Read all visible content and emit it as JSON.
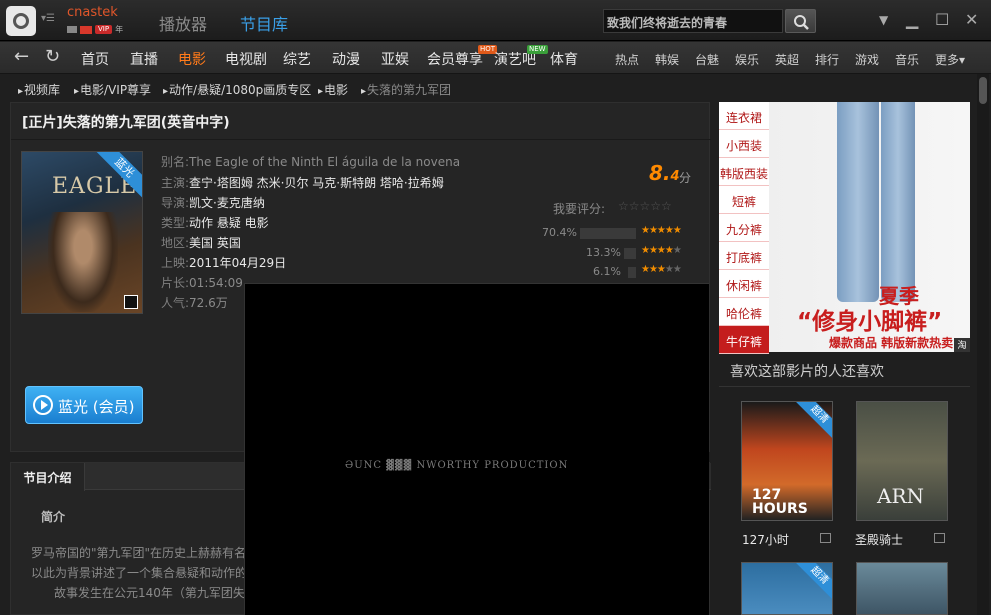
{
  "titlebar": {
    "user_name": "cnastek",
    "vip_label": "VIP",
    "year_label": "年",
    "tabs": [
      {
        "label": "播放器"
      },
      {
        "label": "节目库"
      }
    ],
    "search_value": "致我们终将逝去的青春",
    "icons": [
      "app-logo-icon",
      "menu-icon",
      "search-icon",
      "dropdown-icon",
      "minimize-icon",
      "maximize-icon",
      "close-icon"
    ]
  },
  "nav": {
    "items": [
      {
        "label": "首页"
      },
      {
        "label": "直播"
      },
      {
        "label": "电影"
      },
      {
        "label": "电视剧"
      },
      {
        "label": "综艺"
      },
      {
        "label": "动漫"
      },
      {
        "label": "亚娱"
      },
      {
        "label": "会员尊享"
      },
      {
        "label": "演艺吧"
      },
      {
        "label": "体育"
      }
    ],
    "tag_hot": "HOT",
    "tag_new": "NEW",
    "right": [
      {
        "label": "热点"
      },
      {
        "label": "韩娱"
      },
      {
        "label": "台魅"
      },
      {
        "label": "娱乐"
      },
      {
        "label": "英超"
      },
      {
        "label": "排行"
      },
      {
        "label": "游戏"
      },
      {
        "label": "音乐"
      },
      {
        "label": "更多▾"
      }
    ],
    "active_color": "#ff7a1a"
  },
  "breadcrumb": [
    {
      "label": "视频库"
    },
    {
      "label": "电影/VIP尊享"
    },
    {
      "label": "动作/悬疑/1080p画质专区"
    },
    {
      "label": "电影"
    },
    {
      "label": "失落的第九军团"
    }
  ],
  "movie": {
    "title": "[正片]失落的第九军团(英音中字)",
    "poster_title": "EAGLE",
    "poster_tag": "蓝光",
    "fields": [
      {
        "label": "别名:",
        "value": "The Eagle of the Ninth El águila de la novena"
      },
      {
        "label": "主演:",
        "value": "查宁·塔图姆 杰米·贝尔 马克·斯特朗 塔哈·拉希姆"
      },
      {
        "label": "导演:",
        "value": "凯文·麦克唐纳"
      },
      {
        "label": "类型:",
        "value": "动作 悬疑 电影"
      },
      {
        "label": "地区:",
        "value": "美国 英国"
      },
      {
        "label": "上映:",
        "value": "2011年04月29日"
      },
      {
        "label": "片长:",
        "value": "01:54:09"
      },
      {
        "label": "人气:",
        "value": "72.6万"
      }
    ],
    "score_main": "8.",
    "score_decimal": "4",
    "score_unit": "分",
    "rate_label": "我要评分:",
    "rating_distribution": [
      {
        "pct": "70.4%",
        "fraction": 0.704,
        "stars": 5
      },
      {
        "pct": "13.3%",
        "fraction": 0.133,
        "stars": 4
      },
      {
        "pct": "6.1%",
        "fraction": 0.061,
        "stars": 3
      }
    ],
    "play_label": "蓝光 (会员)"
  },
  "intro": {
    "tab_label": "节目介绍",
    "sub_label": "简介",
    "lines": [
      "罗马帝国的\"第九军团\"在历史上赫赫有名",
      "以此为背景讲述了一个集合悬疑和动作的",
      "故事发生在公元140年（第九军团失"
    ]
  },
  "video": {
    "caption": "ƏUNC ▓▓▓ NWORTHY PRODUCTION"
  },
  "ad": {
    "menu": [
      {
        "label": "连衣裙"
      },
      {
        "label": "小西装"
      },
      {
        "label": "韩版西装"
      },
      {
        "label": "短裤"
      },
      {
        "label": "九分裤"
      },
      {
        "label": "打底裤"
      },
      {
        "label": "休闲裤"
      },
      {
        "label": "哈伦裤"
      },
      {
        "label": "牛仔裤"
      }
    ],
    "season": "夏季",
    "headline": "“修身小脚裤”",
    "sub": "爆款商品 韩版新款热卖",
    "corner": "淘"
  },
  "recommend": {
    "title": "喜欢这部影片的人还喜欢",
    "items": [
      {
        "name": "127小时",
        "poster_text": "127 HOURS",
        "tag": "超清"
      },
      {
        "name": "圣殿骑士",
        "poster_text": "ARN",
        "tag": ""
      },
      {
        "name": "",
        "poster_text": "",
        "tag": "超清"
      },
      {
        "name": "",
        "poster_text": "",
        "tag": ""
      }
    ]
  }
}
